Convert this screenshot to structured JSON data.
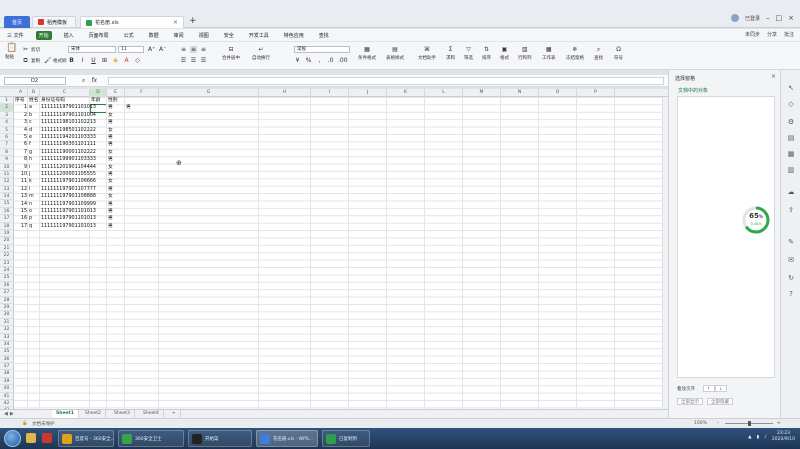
{
  "titlebar": {
    "home_tab": "首页",
    "tab_a": "稻壳模板",
    "tab_b": "花名册.xls",
    "user": "已登录"
  },
  "menu": {
    "items": [
      "三 文件",
      "开始",
      "插入",
      "页面布局",
      "公式",
      "数据",
      "审阅",
      "视图",
      "安全",
      "开发工具",
      "特色应用",
      "查找"
    ],
    "active_index": 1,
    "right": [
      "未同步",
      "分享",
      "批注"
    ]
  },
  "ribbon": {
    "paste": "粘贴",
    "cut": "剪切",
    "copy": "复制",
    "format_painter": "格式刷",
    "font_name": "宋体",
    "font_size": "11",
    "merge": "合并居中",
    "wrap": "自动换行",
    "number_format": "常规",
    "cond_format": "条件格式",
    "table_style": "表格样式",
    "doc_helper": "文档助手",
    "sum": "求和",
    "filter": "筛选",
    "sort": "排序",
    "fmt": "格式",
    "rowcol": "行和列",
    "worksheet": "工作表",
    "freeze": "冻结窗格",
    "find": "查找",
    "symbol": "符号"
  },
  "formula_bar": {
    "name_box": "D2",
    "fx": "fx",
    "content": ""
  },
  "columns": [
    "A",
    "B",
    "C",
    "D",
    "E",
    "F",
    "G",
    "H",
    "I",
    "J",
    "K",
    "L",
    "M",
    "N",
    "O",
    "P"
  ],
  "table": {
    "headers": [
      "序号",
      "姓名",
      "身份证号码",
      "年龄",
      "性别"
    ],
    "rows": [
      [
        "1",
        "a",
        "111111197901101013",
        "",
        "男"
      ],
      [
        "2",
        "b",
        "111111197901101004",
        "",
        "女"
      ],
      [
        "3",
        "c",
        "111111198101102213",
        "",
        "男"
      ],
      [
        "4",
        "d",
        "111111198501102222",
        "",
        "女"
      ],
      [
        "5",
        "e",
        "111111194201103333",
        "",
        "男"
      ],
      [
        "6",
        "f",
        "111111190301101111",
        "",
        "男"
      ],
      [
        "7",
        "g",
        "111111190001102222",
        "",
        "女"
      ],
      [
        "8",
        "h",
        "111111199901103333",
        "",
        "男"
      ],
      [
        "9",
        "i",
        "111111201901104444",
        "",
        "女"
      ],
      [
        "10",
        "j",
        "111111200001105555",
        "",
        "男"
      ],
      [
        "11",
        "k",
        "111111197901106666",
        "",
        "女"
      ],
      [
        "12",
        "l",
        "111111197901107777",
        "",
        "男"
      ],
      [
        "13",
        "m",
        "111111197901108888",
        "",
        "女"
      ],
      [
        "14",
        "n",
        "111111197901109999",
        "",
        "男"
      ],
      [
        "15",
        "o",
        "111111197901101013",
        "",
        "男"
      ],
      [
        "16",
        "p",
        "111111197901101013",
        "",
        "男"
      ],
      [
        "17",
        "q",
        "111111197901101013",
        "",
        "男"
      ]
    ],
    "stray_cell": "男"
  },
  "row_count": 43,
  "sheet_tabs": [
    "Sheet1",
    "Sheet2",
    "Sheet3",
    "Sheet4"
  ],
  "active_sheet": 0,
  "status": {
    "doc_protect": "文档未保护",
    "zoom": "100%"
  },
  "panel": {
    "title": "选择窗格",
    "subtitle": "文档中的对象",
    "order_label": "叠放次序",
    "show_all": "全部显示",
    "hide_all": "全部隐藏"
  },
  "gauge": {
    "percent_text": "65",
    "percent_unit": "%",
    "sub": "0.4K/s",
    "value": 0.65,
    "color": "#2ea84b"
  },
  "taskbar": {
    "items": [
      "百度号 - 360安全...",
      "360安全卫士",
      "开始菜",
      "花名册.xls - WPS...",
      "已复制到"
    ],
    "time": "23:23",
    "date": "2020/9/10"
  },
  "colors": {
    "accent": "#2e7d32",
    "selection": "#1e8a3c",
    "tab_blue": "#3d6fd8"
  }
}
